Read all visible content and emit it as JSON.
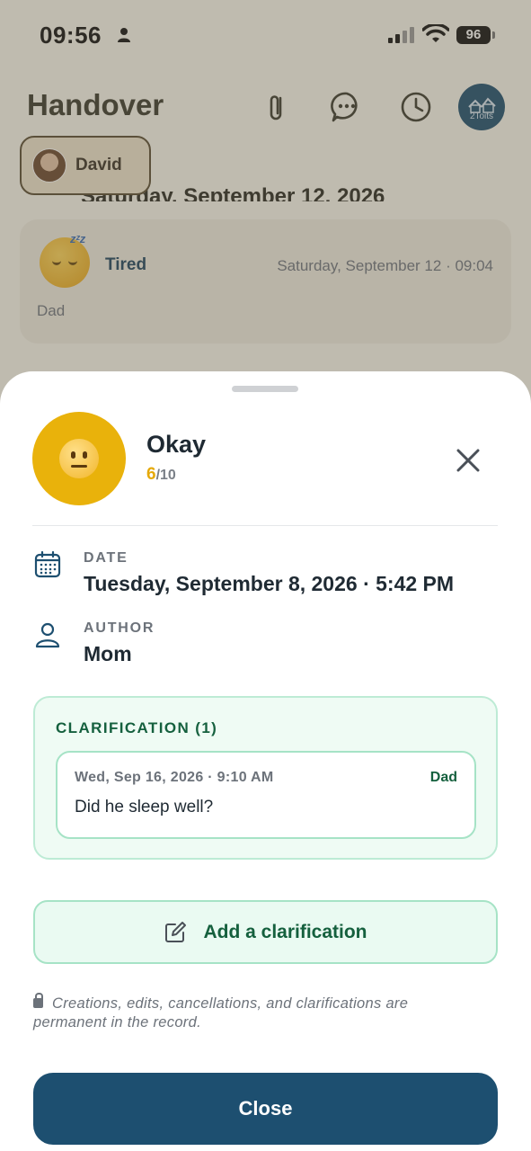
{
  "status_bar": {
    "time": "09:56",
    "battery": "96"
  },
  "header": {
    "title": "Handover",
    "logo_text": "2Toits",
    "icons": [
      "paperclip-icon",
      "chat-icon",
      "clock-icon"
    ]
  },
  "filter_chip": {
    "name": "David"
  },
  "background": {
    "date_heading": "Saturday, September 12, 2026",
    "entry": {
      "mood": "Tired",
      "datetime": "Saturday, September 12 · 09:04",
      "author": "Dad",
      "emoji": "sleeping-face"
    }
  },
  "sheet": {
    "mood": {
      "label": "Okay",
      "score": "6",
      "max": "/10",
      "emoji": "neutral-face",
      "color": "#e9b20b"
    },
    "date": {
      "label": "DATE",
      "value": "Tuesday, September 8, 2026 · 5:42 PM"
    },
    "author": {
      "label": "AUTHOR",
      "value": "Mom"
    },
    "clarifications": {
      "title": "CLARIFICATION (1)",
      "items": [
        {
          "date": "Wed, Sep 16, 2026 · 9:10 AM",
          "author": "Dad",
          "text": "Did he sleep well?"
        }
      ]
    },
    "add_button": {
      "label": "Add a clarification"
    },
    "notice": "Creations, edits, cancellations, and clarifications are permanent in the record.",
    "close_button": {
      "label": "Close"
    }
  },
  "colors": {
    "primary": "#1d4f70",
    "success": "#15603e",
    "mood_okay": "#e9b20b"
  }
}
